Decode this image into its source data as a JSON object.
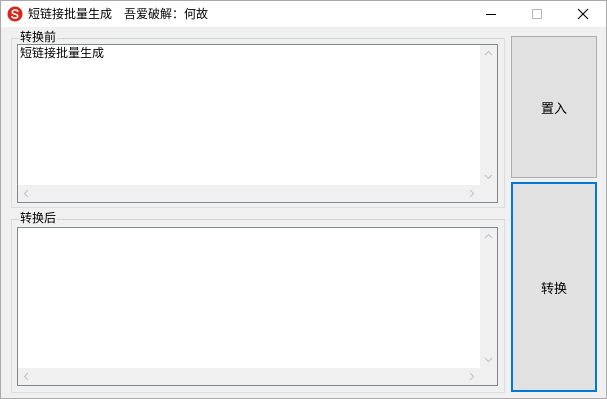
{
  "window": {
    "title": "短链接批量生成",
    "subtitle": "吾爱破解：何故",
    "icon": "app-logo-icon",
    "controls": {
      "minimize_icon": "minimize-icon",
      "maximize_icon": "maximize-icon",
      "close_icon": "close-icon"
    }
  },
  "before": {
    "label": "转换前",
    "content": "短链接批量生成"
  },
  "after": {
    "label": "转换后",
    "content": ""
  },
  "buttons": {
    "import_label": "置入",
    "convert_label": "转换"
  },
  "colors": {
    "accent": "#0078d7",
    "logo_red": "#d9261c"
  }
}
